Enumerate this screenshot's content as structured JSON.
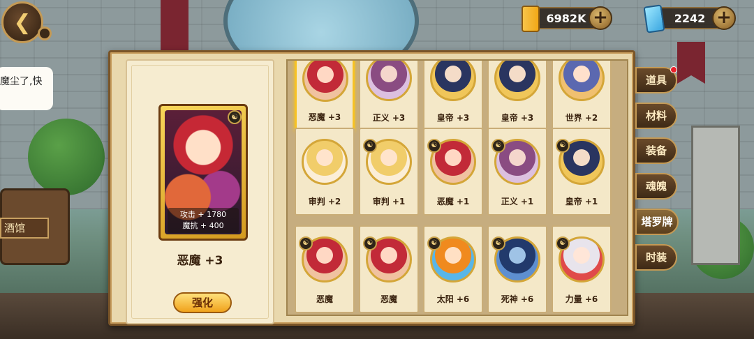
{
  "top_bar": {
    "gold_value": "6982K",
    "gem_value": "2242",
    "plus_label": "+"
  },
  "background": {
    "speech_text": "魔尘了,快",
    "tavern_sign": "酒馆"
  },
  "detail": {
    "card_name": "恶魔 +3",
    "stat_attack": "攻击 + 1780",
    "stat_magic_resist": "魔抗 + 400",
    "upgrade_label": "强化"
  },
  "grid": {
    "rows": [
      [
        {
          "label": "恶魔 +3",
          "portrait": "red",
          "selected": true
        },
        {
          "label": "正义 +3",
          "portrait": "purple"
        },
        {
          "label": "皇帝 +3",
          "portrait": "navy"
        },
        {
          "label": "皇帝 +3",
          "portrait": "navy"
        },
        {
          "label": "世界 +2",
          "portrait": "mixed"
        }
      ],
      [
        {
          "label": "审判 +2",
          "portrait": "blonde"
        },
        {
          "label": "审判 +1",
          "portrait": "blonde",
          "badge": true
        },
        {
          "label": "恶魔 +1",
          "portrait": "red",
          "badge": true
        },
        {
          "label": "正义 +1",
          "portrait": "purple",
          "badge": true
        },
        {
          "label": "皇帝 +1",
          "portrait": "navy",
          "badge": true
        }
      ],
      [
        {
          "label": "恶魔",
          "portrait": "red",
          "badge": true
        },
        {
          "label": "恶魔",
          "portrait": "red",
          "badge": true
        },
        {
          "label": "太阳 +6",
          "portrait": "orange",
          "badge": true
        },
        {
          "label": "死神 +6",
          "portrait": "dark",
          "badge": true
        },
        {
          "label": "力量 +6",
          "portrait": "white",
          "badge": true
        }
      ]
    ]
  },
  "tabs": [
    {
      "label": "道具",
      "notify": true
    },
    {
      "label": "材料"
    },
    {
      "label": "装备"
    },
    {
      "label": "魂魄"
    },
    {
      "label": "塔罗牌",
      "active": true
    },
    {
      "label": "时装"
    }
  ],
  "colors": {
    "accent_gold": "#f6c224",
    "panel_bg": "#e9d8ad",
    "frame_brown": "#7a5528"
  }
}
